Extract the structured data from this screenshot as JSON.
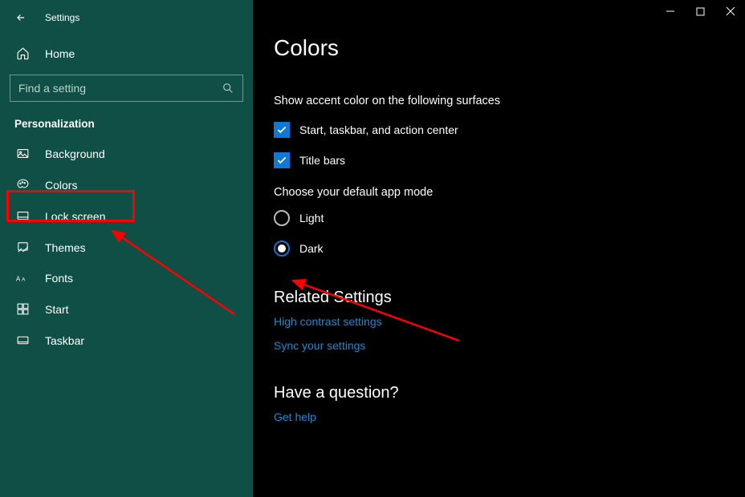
{
  "titlebar": {
    "title": "Settings"
  },
  "home": {
    "label": "Home"
  },
  "search": {
    "placeholder": "Find a setting"
  },
  "section_title": "Personalization",
  "nav_items": [
    {
      "label": "Background"
    },
    {
      "label": "Colors"
    },
    {
      "label": "Lock screen"
    },
    {
      "label": "Themes"
    },
    {
      "label": "Fonts"
    },
    {
      "label": "Start"
    },
    {
      "label": "Taskbar"
    }
  ],
  "page_title": "Colors",
  "surfaces_heading": "Show accent color on the following surfaces",
  "surface_checks": [
    {
      "label": "Start, taskbar, and action center"
    },
    {
      "label": "Title bars"
    }
  ],
  "mode_heading": "Choose your default app mode",
  "modes": [
    {
      "label": "Light"
    },
    {
      "label": "Dark"
    }
  ],
  "related_heading": "Related Settings",
  "related_links": [
    "High contrast settings",
    "Sync your settings"
  ],
  "question_heading": "Have a question?",
  "question_link": "Get help"
}
